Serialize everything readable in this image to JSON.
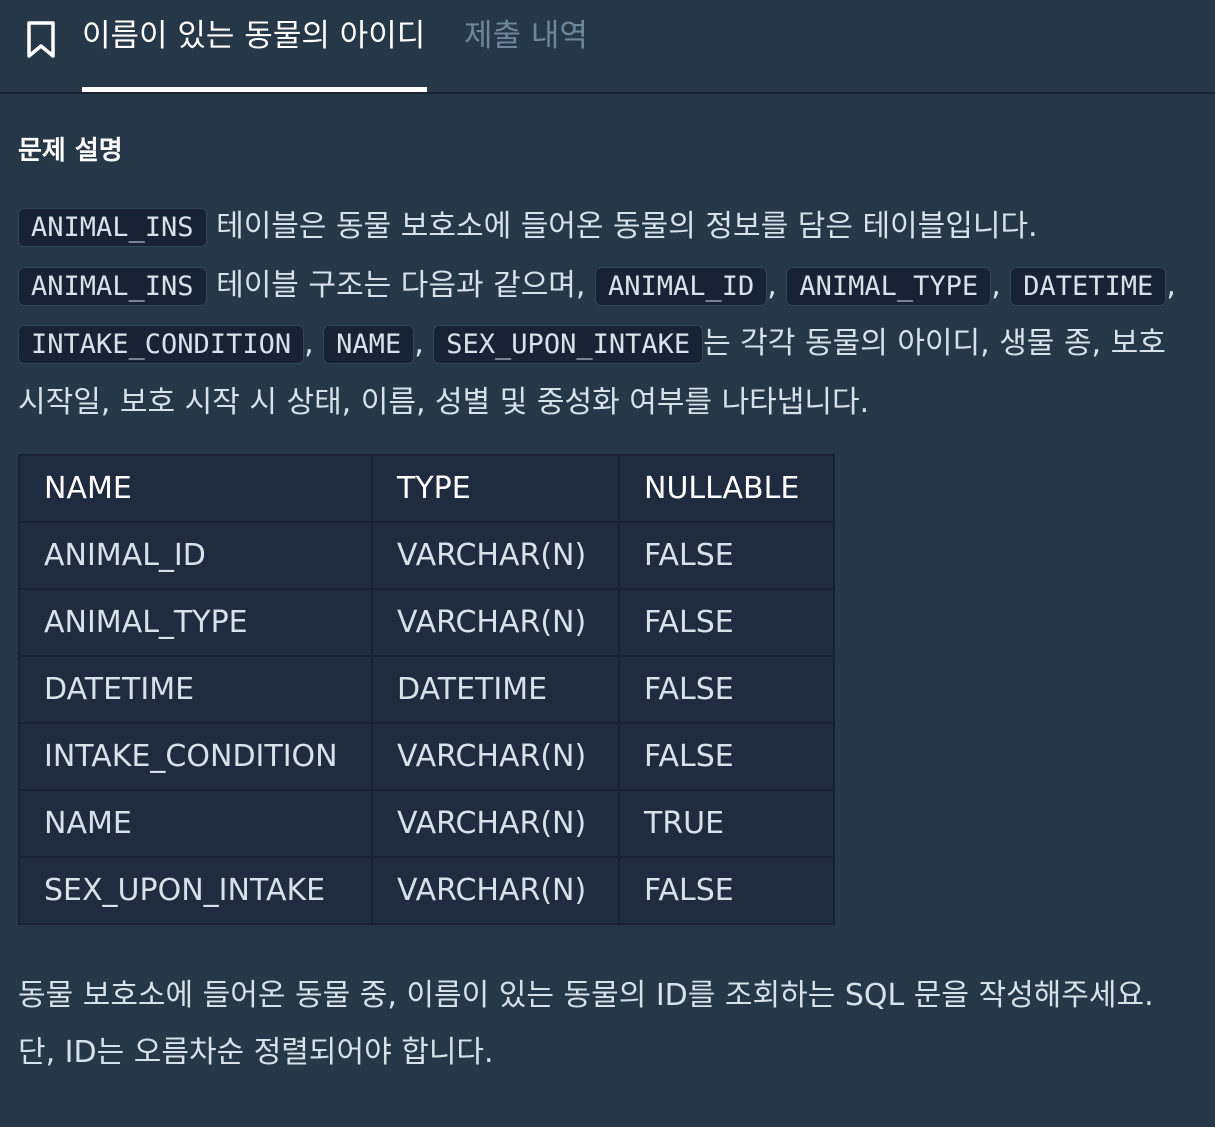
{
  "tabs": {
    "active_label": "이름이 있는 동물의 아이디",
    "inactive_label": "제출 내역"
  },
  "problem": {
    "section_title": "문제 설명",
    "desc": {
      "table_name": "ANIMAL_INS",
      "text_1": " 테이블은 동물 보호소에 들어온 동물의 정보를 담은 테이블입니다.",
      "text_2": " 테이블 구조는 다음과 같으며, ",
      "columns": [
        "ANIMAL_ID",
        "ANIMAL_TYPE",
        "DATETIME",
        "INTAKE_CONDITION",
        "NAME",
        "SEX_UPON_INTAKE"
      ],
      "comma": ", ",
      "text_3": "는 각각 동물의 아이디, 생물 종, 보호 시작일, 보호 시작 시 상태, 이름, 성별 및 중성화 여부를 나타냅니다."
    },
    "table": {
      "headers": [
        "NAME",
        "TYPE",
        "NULLABLE"
      ],
      "rows": [
        [
          "ANIMAL_ID",
          "VARCHAR(N)",
          "FALSE"
        ],
        [
          "ANIMAL_TYPE",
          "VARCHAR(N)",
          "FALSE"
        ],
        [
          "DATETIME",
          "DATETIME",
          "FALSE"
        ],
        [
          "INTAKE_CONDITION",
          "VARCHAR(N)",
          "FALSE"
        ],
        [
          "NAME",
          "VARCHAR(N)",
          "TRUE"
        ],
        [
          "SEX_UPON_INTAKE",
          "VARCHAR(N)",
          "FALSE"
        ]
      ]
    },
    "requirement": "동물 보호소에 들어온 동물 중, 이름이 있는 동물의 ID를 조회하는 SQL 문을 작성해주세요. 단, ID는 오름차순 정렬되어야 합니다."
  },
  "icons": {
    "bookmark": "bookmark-icon"
  },
  "colors": {
    "background": "#263747",
    "panel": "#1f2b3e",
    "border": "#172334",
    "inactive_tab": "#6d8699"
  }
}
